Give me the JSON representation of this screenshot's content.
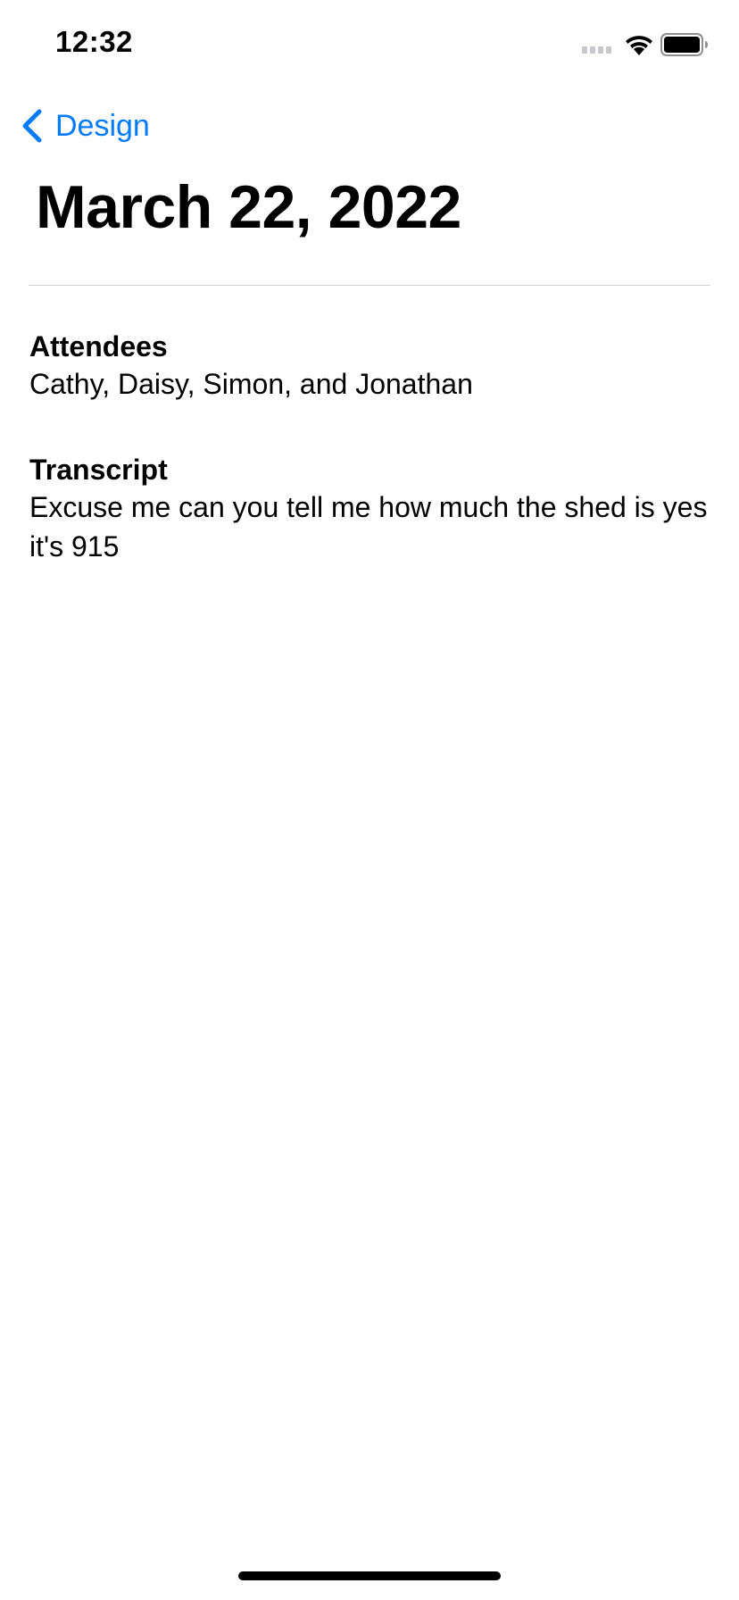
{
  "status_bar": {
    "time": "12:32",
    "icons": [
      "cellular-signal-icon",
      "wifi-icon",
      "battery-icon"
    ]
  },
  "nav": {
    "back_label": "Design",
    "back_icon": "chevron-left-icon",
    "accent_color": "#007aff"
  },
  "page": {
    "title": "March 22, 2022"
  },
  "sections": {
    "attendees": {
      "heading": "Attendees",
      "body": "Cathy, Daisy, Simon, and Jonathan"
    },
    "transcript": {
      "heading": "Transcript",
      "body": "Excuse me can you tell me how much the shed is yes it's 915"
    }
  }
}
